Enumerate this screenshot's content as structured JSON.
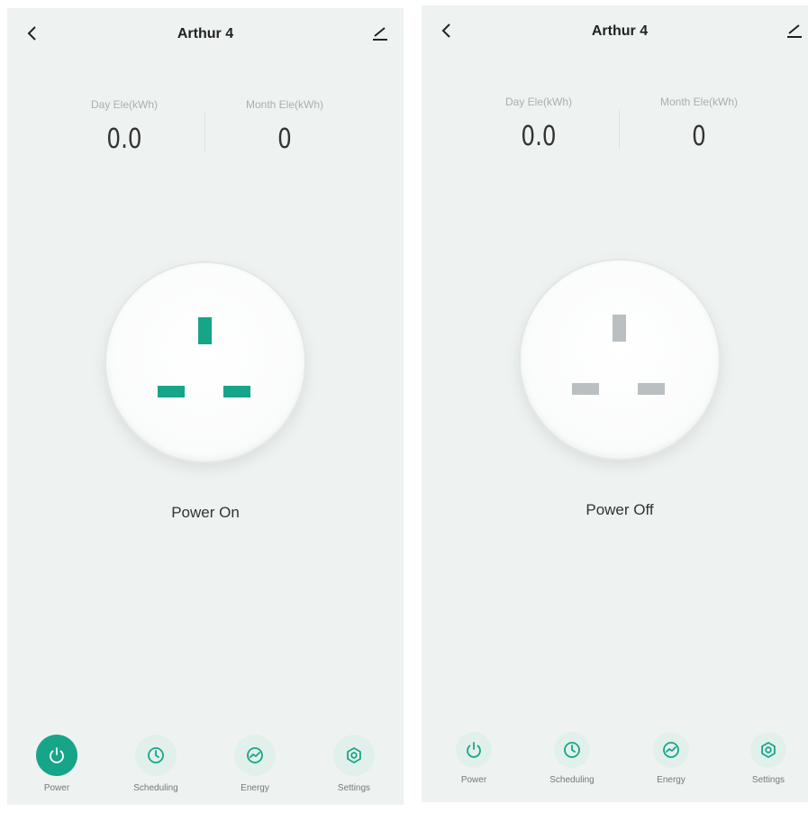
{
  "screens": [
    {
      "title": "Arthur 4",
      "day_label": "Day Ele(kWh)",
      "day_value": "0.0",
      "month_label": "Month Ele(kWh)",
      "month_value": "0",
      "status": "Power On",
      "power_state": "on",
      "pin_color": "#17a589"
    },
    {
      "title": "Arthur 4",
      "day_label": "Day Ele(kWh)",
      "day_value": "0.0",
      "month_label": "Month Ele(kWh)",
      "month_value": "0",
      "status": "Power Off",
      "power_state": "off",
      "pin_color": "#babfc2"
    }
  ],
  "tabs": {
    "power": "Power",
    "scheduling": "Scheduling",
    "energy": "Energy",
    "settings": "Settings"
  },
  "colors": {
    "accent": "#17a589",
    "background": "#eef3f1"
  },
  "icons": {
    "back": "chevron-left-icon",
    "edit": "edit-icon",
    "power": "power-icon",
    "scheduling": "clock-icon",
    "energy": "energy-icon",
    "settings": "gear-icon"
  }
}
